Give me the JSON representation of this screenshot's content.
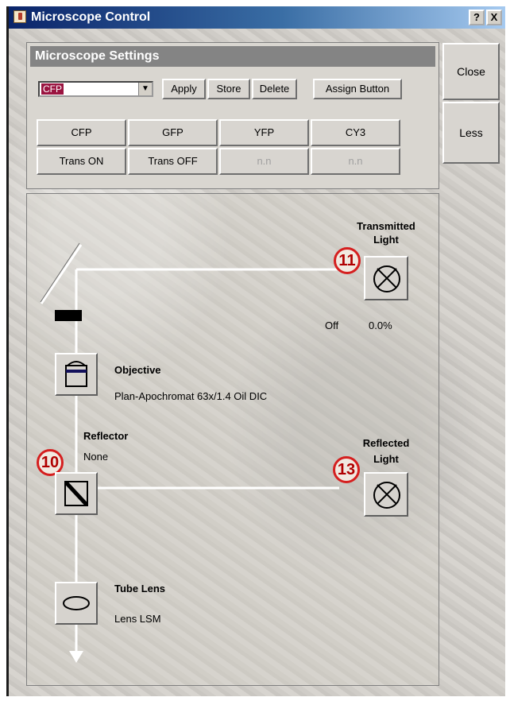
{
  "window": {
    "title": "Microscope Control",
    "help_label": "?",
    "close_label": "X"
  },
  "settings": {
    "header": "Microscope Settings",
    "selected_setting": "CFP",
    "buttons": {
      "apply": "Apply",
      "store": "Store",
      "delete": "Delete",
      "assign": "Assign Button"
    },
    "presets": [
      "CFP",
      "GFP",
      "YFP",
      "CY3",
      "Trans ON",
      "Trans OFF",
      "n.n",
      "n.n"
    ]
  },
  "side_buttons": {
    "close": "Close",
    "less": "Less"
  },
  "light_path": {
    "transmitted": {
      "title": "Transmitted Light",
      "title_line1": "Transmitted",
      "title_line2": "Light",
      "status": "Off",
      "percent": "0.0%",
      "badge": "11"
    },
    "objective": {
      "title": "Objective",
      "value": "Plan-Apochromat 63x/1.4 Oil DIC"
    },
    "reflector": {
      "title": "Reflector",
      "value": "None",
      "badge": "10"
    },
    "reflected": {
      "title": "Reflected Light",
      "title_line1": "Reflected",
      "title_line2": "Light",
      "badge": "13"
    },
    "tube_lens": {
      "title": "Tube Lens",
      "value": "Lens LSM"
    }
  },
  "colors": {
    "title_bar": "#0a246a",
    "header_bg": "#848484",
    "selection": "#9a1440",
    "badge_ring": "#d51f1f"
  }
}
